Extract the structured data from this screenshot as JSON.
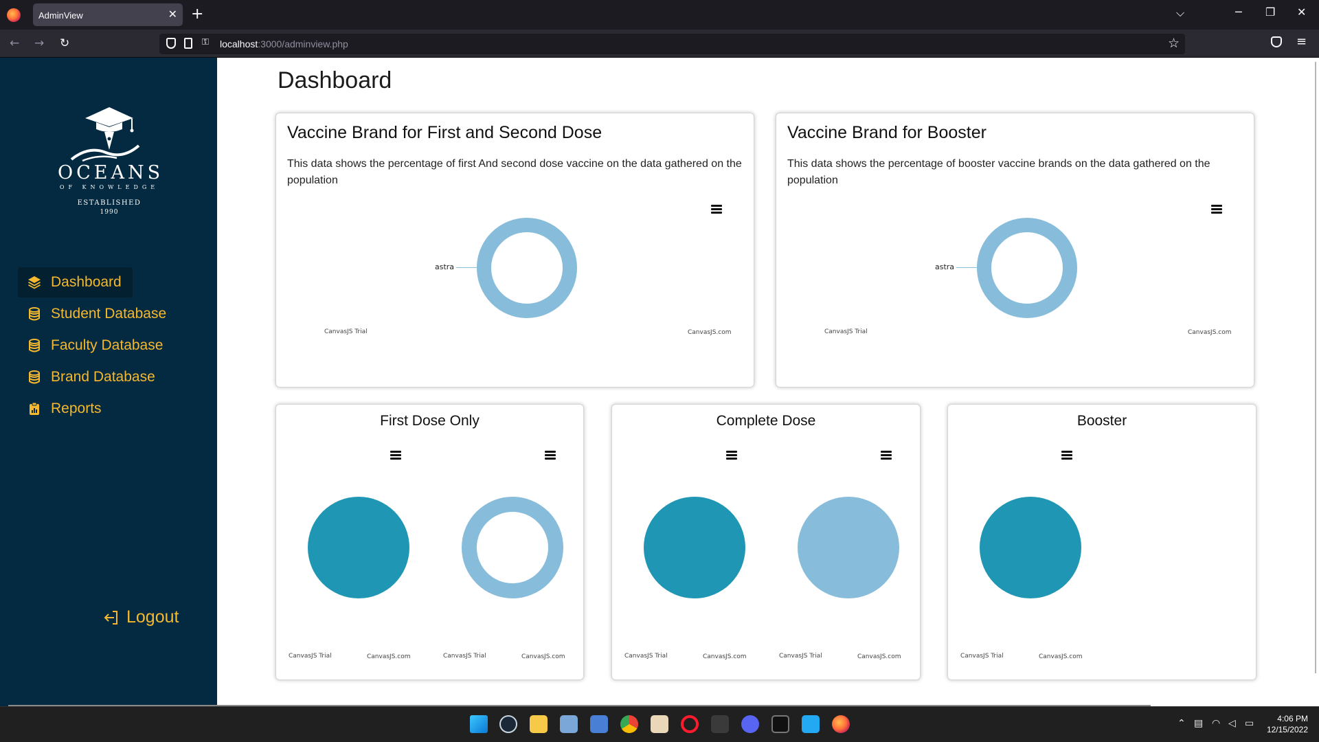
{
  "browser": {
    "tab_title": "AdminView",
    "close_glyph": "✕",
    "new_tab_glyph": "+",
    "url_host": "localhost",
    "url_rest": ":3000/adminview.php",
    "tabs_list_glyph": "⌵",
    "minimize_glyph": "─",
    "restore_glyph": "❐",
    "close_window_glyph": "✕",
    "back_glyph": "←",
    "forward_glyph": "→",
    "reload_glyph": "↻",
    "star_glyph": "☆",
    "menu_glyph": "≡",
    "perm_glyph": "⚿"
  },
  "sidebar": {
    "logo": {
      "brand": "OCEANS",
      "tagline": "OF KNOWLEDGE",
      "established": "ESTABLISHED",
      "year": "1990"
    },
    "items": [
      {
        "label": "Dashboard",
        "icon": "layers-icon",
        "active": true
      },
      {
        "label": "Student Database",
        "icon": "database-icon"
      },
      {
        "label": "Faculty Database",
        "icon": "database-icon"
      },
      {
        "label": "Brand Database",
        "icon": "database-icon"
      },
      {
        "label": "Reports",
        "icon": "clipboard-chart-icon"
      }
    ],
    "logout": "Logout"
  },
  "main": {
    "title": "Dashboard",
    "cards": [
      {
        "title": "Vaccine Brand for First and Second Dose",
        "description": "This data shows the percentage of first And second dose vaccine on the data gathered on the population",
        "chart": {
          "label": "astra",
          "credit_left": "CanvasJS Trial",
          "credit_right": "CanvasJS.com"
        }
      },
      {
        "title": "Vaccine Brand for Booster",
        "description": "This data shows the percentage of booster vaccine brands on the data gathered on the population",
        "chart": {
          "label": "astra",
          "credit_left": "CanvasJS Trial",
          "credit_right": "CanvasJS.com"
        }
      }
    ],
    "small_cards": [
      {
        "title": "First Dose Only",
        "credits": [
          "CanvasJS Trial",
          "CanvasJS.com",
          "CanvasJS Trial",
          "CanvasJS.com"
        ]
      },
      {
        "title": "Complete Dose",
        "credits": [
          "CanvasJS Trial",
          "CanvasJS.com",
          "CanvasJS Trial",
          "CanvasJS.com"
        ]
      },
      {
        "title": "Booster",
        "credits": [
          "CanvasJS Trial",
          "CanvasJS.com"
        ]
      }
    ]
  },
  "colors": {
    "sidebar_bg": "#032a40",
    "accent": "#f5b82e",
    "pie_teal": "#1f96b4",
    "pie_light": "#87bddb"
  },
  "taskbar": {
    "time": "4:06 PM",
    "date": "12/15/2022",
    "apps": [
      "windows-start-icon",
      "steam-icon",
      "file-explorer-icon",
      "photos-icon",
      "store-icon",
      "chrome-icon",
      "game-icon",
      "opera-icon",
      "notion-icon",
      "discord-icon",
      "terminal-icon",
      "vscode-icon",
      "firefox-icon"
    ]
  }
}
